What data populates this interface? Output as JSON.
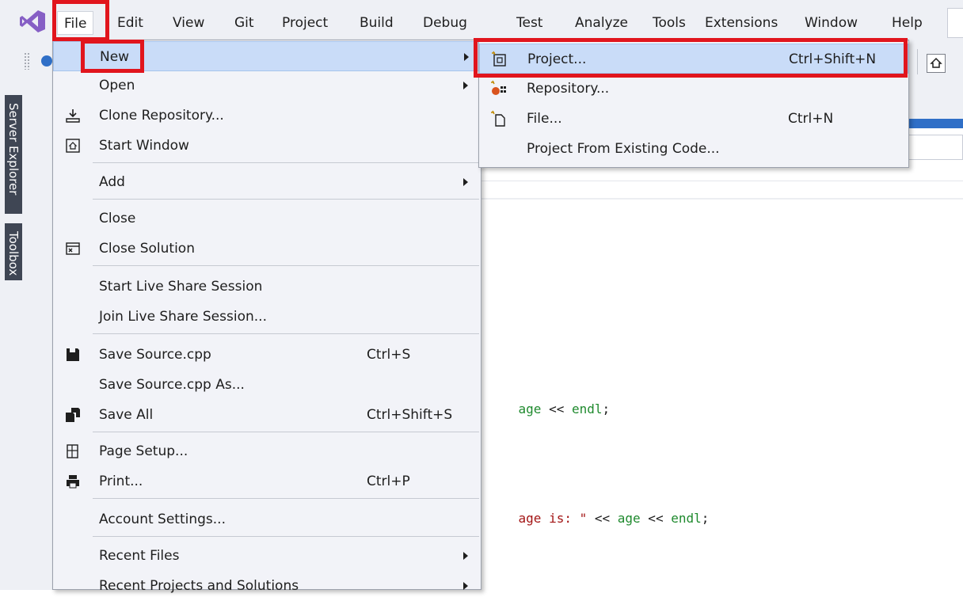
{
  "menubar": {
    "items": [
      "File",
      "Edit",
      "View",
      "Git",
      "Project",
      "Build",
      "Debug",
      "Test",
      "Analyze",
      "Tools",
      "Extensions",
      "Window",
      "Help"
    ]
  },
  "sidebar": {
    "server_explorer": "Server Explorer",
    "toolbox": "Toolbox"
  },
  "file_menu": {
    "new": "New",
    "open": "Open",
    "clone_repository": "Clone Repository...",
    "start_window": "Start Window",
    "add": "Add",
    "close": "Close",
    "close_solution": "Close Solution",
    "start_live_share": "Start Live Share Session",
    "join_live_share": "Join Live Share Session...",
    "save_source": "Save Source.cpp",
    "save_source_shortcut": "Ctrl+S",
    "save_source_as": "Save Source.cpp As...",
    "save_all": "Save All",
    "save_all_shortcut": "Ctrl+Shift+S",
    "page_setup": "Page Setup...",
    "print": "Print...",
    "print_shortcut": "Ctrl+P",
    "account_settings": "Account Settings...",
    "recent_files": "Recent Files",
    "recent_projects": "Recent Projects and Solutions"
  },
  "new_menu": {
    "project": "Project...",
    "project_shortcut": "Ctrl+Shift+N",
    "repository": "Repository...",
    "file": "File...",
    "file_shortcut": "Ctrl+N",
    "from_existing": "Project From Existing Code..."
  },
  "code": {
    "line1": [
      "age",
      " << ",
      "endl",
      ";"
    ],
    "line2": [
      "age is: \"",
      " << ",
      "age",
      " << ",
      "endl",
      ";"
    ]
  },
  "colors": {
    "highlight": "#c9dcf8",
    "annotation_red": "#e1151d",
    "vs_purple": "#865fc5"
  }
}
